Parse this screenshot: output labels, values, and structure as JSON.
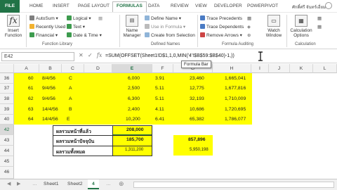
{
  "ribbon_tabs": [
    "FILE",
    "HOME",
    "INSERT",
    "PAGE LAYOUT",
    "FORMULAS",
    "DATA",
    "REVIEW",
    "VIEW",
    "DEVELOPER",
    "POWERPIVOT"
  ],
  "user": "ศักดิ์ศรี จันทร์เอี่ยม",
  "insert_function": "Insert Function",
  "function_library": {
    "items": [
      "AutoSum",
      "Recently Used",
      "Financial",
      "Logical",
      "Text",
      "Date & Time"
    ],
    "label": "Function Library"
  },
  "defined_names": {
    "name_manager": "Name Manager",
    "items": [
      "Define Name",
      "Use in Formula",
      "Create from Selection"
    ],
    "label": "Defined Names"
  },
  "formula_auditing": {
    "items": [
      "Trace Precedents",
      "Trace Dependents",
      "Remove Arrows"
    ],
    "watch": "Watch Window",
    "label": "Formula Auditing"
  },
  "calculation": {
    "options": "Calculation Options",
    "label": "Calculation"
  },
  "name_box": "E42",
  "formula": "=SUM(OFFSET(Sheet1!D$1,1,0,MIN('4'!$B$59:$B$40)-1,))",
  "tooltip": "Formula Bar",
  "columns": [
    "A",
    "B",
    "C",
    "D",
    "E",
    "F",
    "G",
    "H",
    "I",
    "J",
    "K",
    "L"
  ],
  "rows": [
    {
      "num": "36",
      "a": "60",
      "b": "8/4/56",
      "c": "C",
      "e": "6,000",
      "f": "3.91",
      "g": "23,460",
      "h": "1,665,041"
    },
    {
      "num": "37",
      "a": "61",
      "b": "9/4/56",
      "c": "A",
      "e": "2,500",
      "f": "5.11",
      "g": "12,775",
      "h": "1,677,816"
    },
    {
      "num": "38",
      "a": "62",
      "b": "9/4/56",
      "c": "A",
      "e": "6,300",
      "f": "5.11",
      "g": "32,193",
      "h": "1,710,009"
    },
    {
      "num": "39",
      "a": "63",
      "b": "14/4/56",
      "c": "B",
      "e": "2,400",
      "f": "4.11",
      "g": "10,686",
      "h": "1,720,695"
    },
    {
      "num": "40",
      "a": "64",
      "b": "14/4/56",
      "c": "E",
      "e": "10,200",
      "f": "6.41",
      "g": "65,382",
      "h": "1,786,077"
    },
    {
      "num": "41"
    },
    {
      "num": "42",
      "label": "ผลรวมหน้าที่แล้ว",
      "e": "208,000"
    },
    {
      "num": "43",
      "label": "ผลรวมหน้าปัจจุบัน",
      "e": "185,700",
      "g": "857,896"
    },
    {
      "num": "44",
      "label": "ผลรวมทั้งหมด",
      "e": "1,311,200",
      "g": "5,950,198"
    },
    {
      "num": "45"
    },
    {
      "num": "46"
    }
  ],
  "sheets": [
    "Sheet1",
    "Sheet2",
    "4"
  ],
  "active_sheet": "4",
  "colors": {
    "excel_green": "#217346",
    "highlight": "#ffff00"
  }
}
